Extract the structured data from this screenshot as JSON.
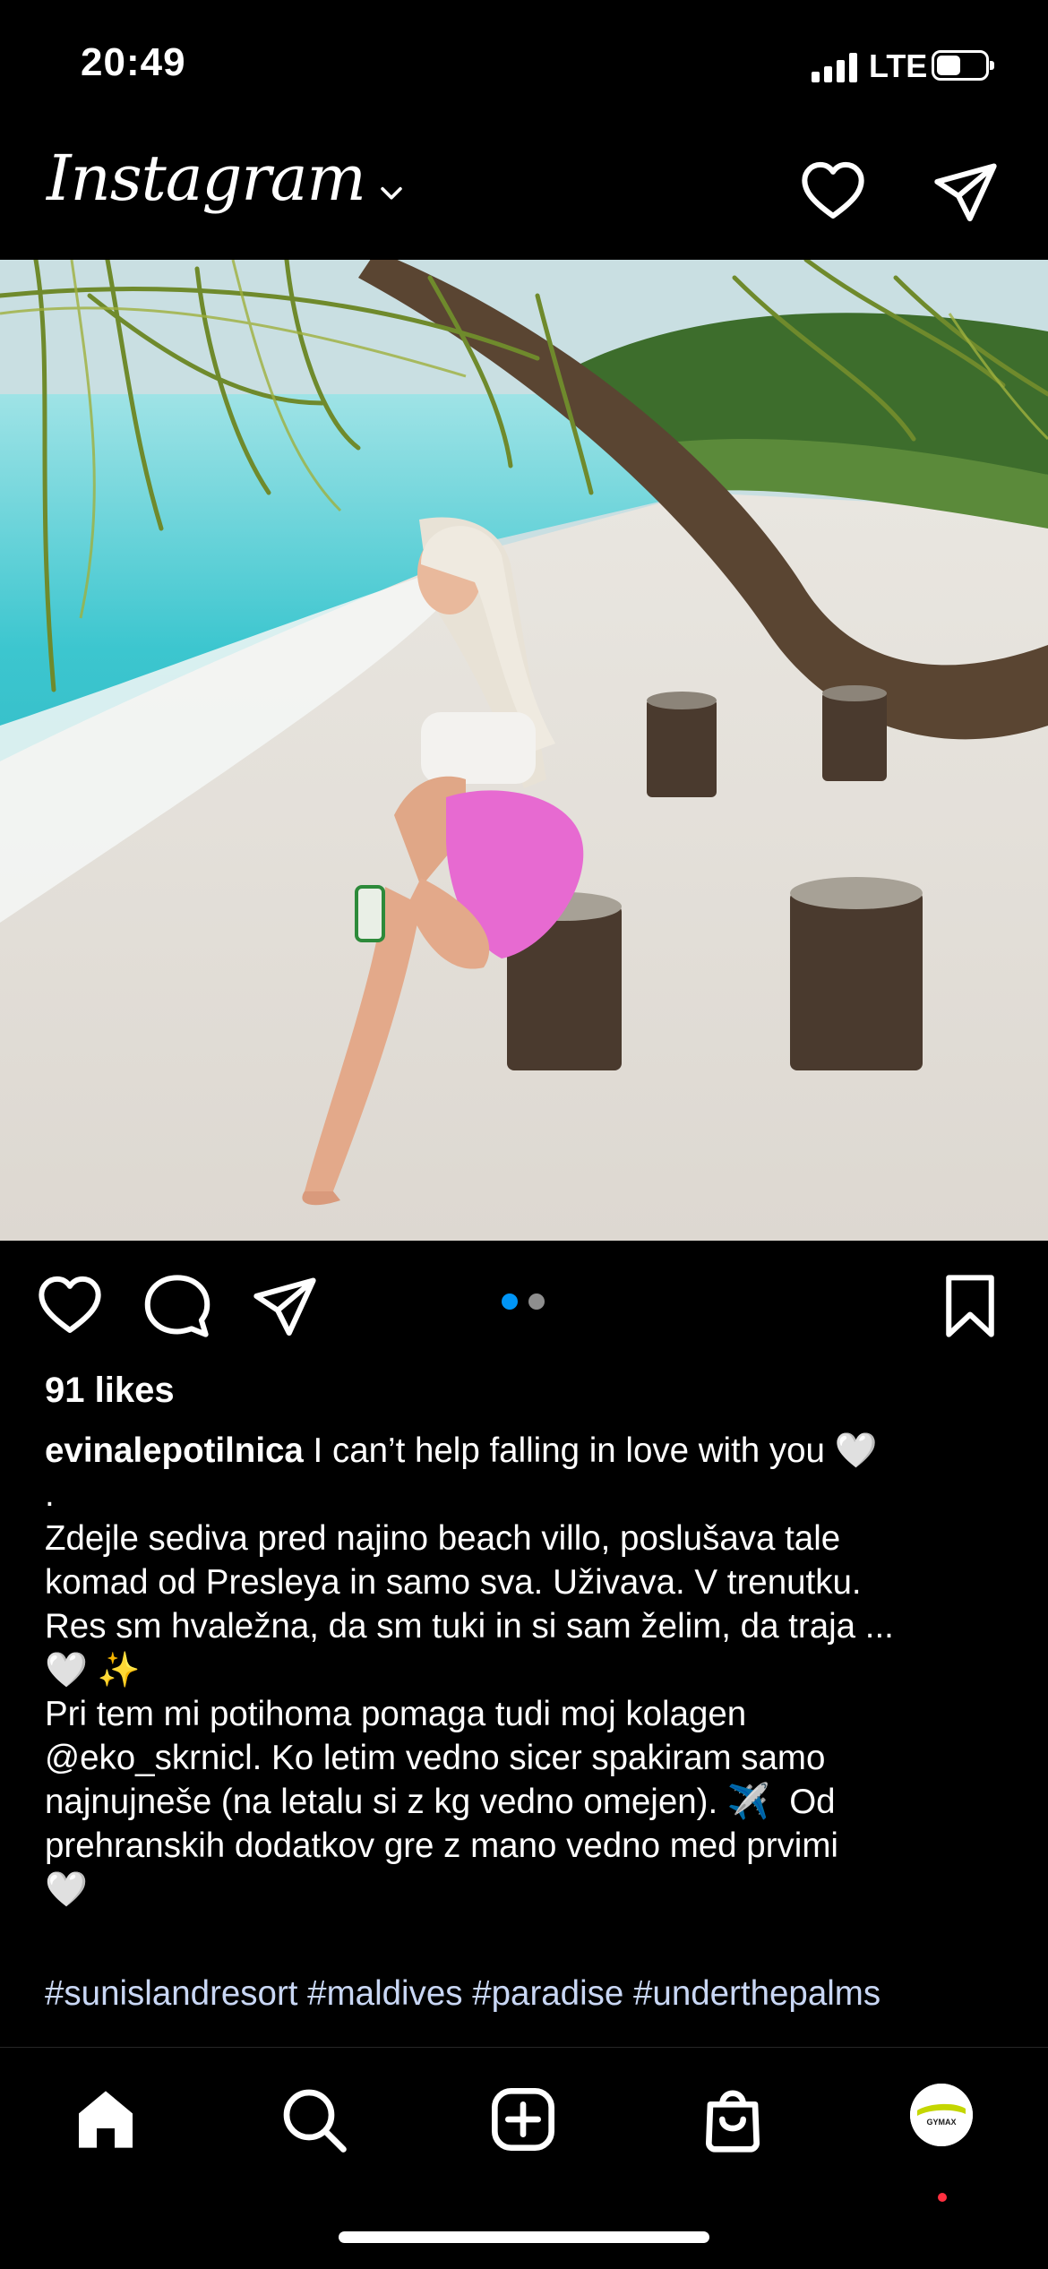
{
  "status": {
    "time": "20:49",
    "network": "LTE"
  },
  "header": {
    "logo": "Instagram",
    "icons": [
      "chevron-down-icon",
      "heart-icon",
      "send-icon"
    ]
  },
  "post": {
    "image_description_icon": "photo",
    "carousel": {
      "count": 2,
      "active": 0,
      "active_color": "#0095f6",
      "inactive_color": "#8e8e8e"
    },
    "likes": "91 likes",
    "username": "evinalepotilnica",
    "caption": " I can’t help falling in love with you 🤍\n.\nZdejle sediva pred najino beach villo, poslušava tale\nkomad od Presleya in samo sva. Uživava. V trenutku.\nRes sm hvaležna, da sm tuki in si sam želim, da traja ...\n🤍 ✨\nPri tem mi potihoma pomaga tudi moj kolagen\n@eko_skrnicl. Ko letim vedno sicer spakiram samo\nnajnujneše (na letalu si z kg vedno omejen). ✈️  Od\nprehranskih dodatkov gre z mano vedno med prvimi\n🤍",
    "hashtags": "#sunislandresort #maldives #paradise #underthepalms"
  },
  "tabbar": {
    "items": [
      "home-icon",
      "search-icon",
      "new-post-icon",
      "shop-icon",
      "profile-avatar"
    ],
    "avatar_label": "GYMAX"
  }
}
